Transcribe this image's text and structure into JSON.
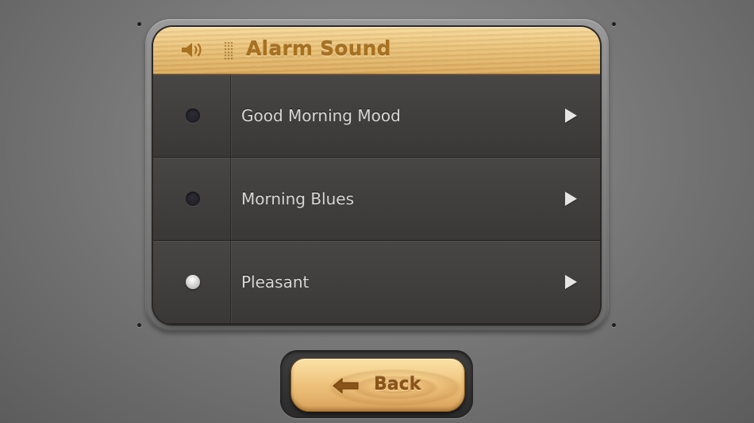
{
  "header": {
    "title": "Alarm Sound",
    "speaker_icon": "speaker-icon"
  },
  "sounds": [
    {
      "label": "Good Morning Mood",
      "selected": false
    },
    {
      "label": "Morning Blues",
      "selected": false
    },
    {
      "label": "Pleasant",
      "selected": true
    }
  ],
  "back_button": {
    "label": "Back",
    "icon": "back-arrow-icon"
  },
  "colors": {
    "wood_light": "#f6d99c",
    "wood_dark": "#d9a95c",
    "title_text": "#a8711f",
    "row_bg": "#3d3b3a",
    "row_text": "#d9d7d5",
    "back_text": "#8a5318"
  }
}
